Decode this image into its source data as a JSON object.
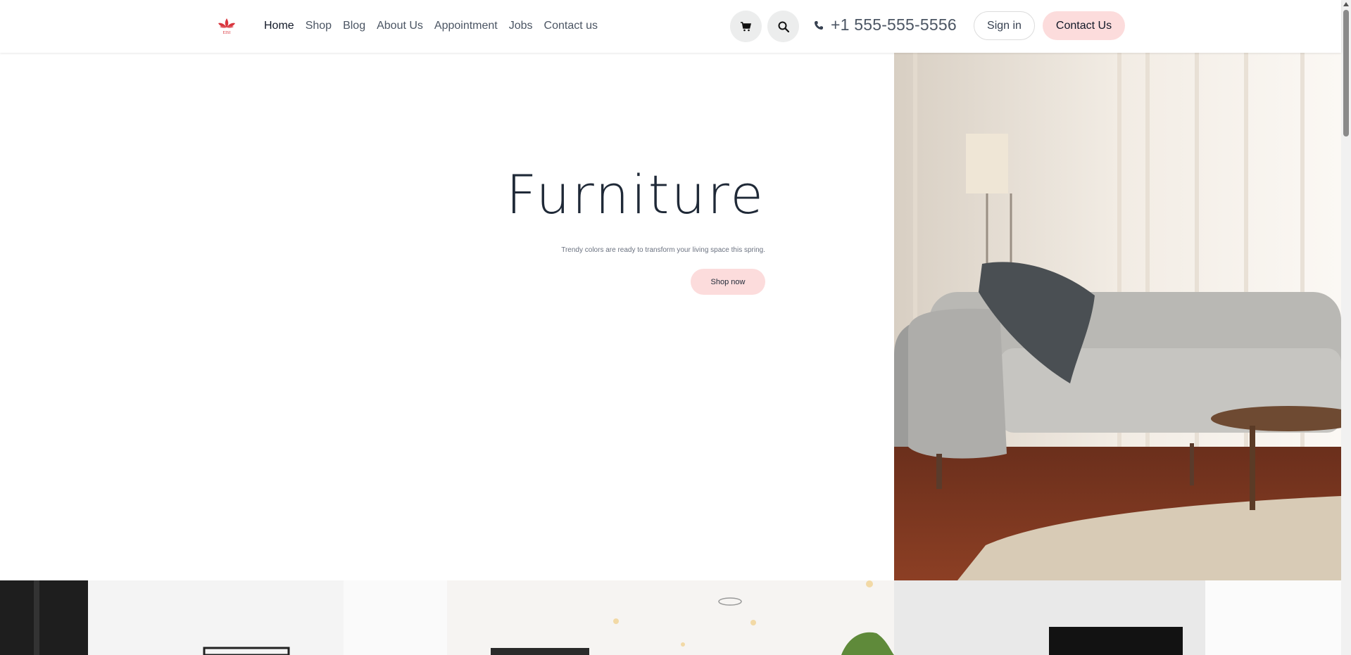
{
  "nav": {
    "logo_text": "EISI",
    "items": [
      {
        "label": "Home",
        "active": true
      },
      {
        "label": "Shop"
      },
      {
        "label": "Blog"
      },
      {
        "label": "About Us"
      },
      {
        "label": "Appointment"
      },
      {
        "label": "Jobs"
      },
      {
        "label": "Contact us"
      }
    ]
  },
  "header": {
    "cart_icon": "cart-icon",
    "search_icon": "search-icon",
    "phone_icon": "phone-icon",
    "phone": "+1 555-555-5556",
    "signin_label": "Sign in",
    "contact_label": "Contact Us"
  },
  "hero": {
    "title": "Furniture",
    "subtitle": "Trendy colors are ready to transform your living space this spring.",
    "cta_label": "Shop now"
  },
  "colors": {
    "accent_pink": "#fcdcdc",
    "logo_red": "#d9363e"
  }
}
